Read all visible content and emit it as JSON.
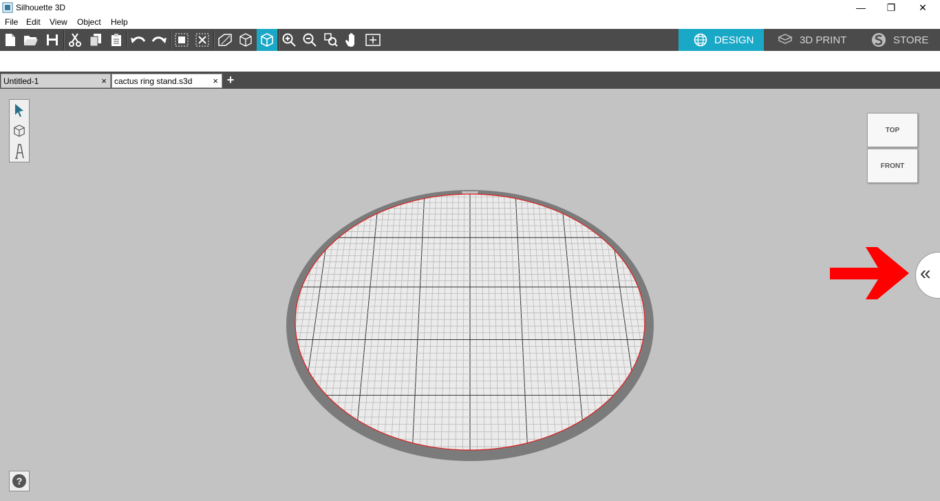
{
  "window": {
    "title": "Silhouette 3D",
    "minimize": "—",
    "restore": "❐",
    "close": "✕"
  },
  "menu": [
    "File",
    "Edit",
    "View",
    "Object",
    "Help"
  ],
  "toolbar": {
    "icons": [
      "new-file-icon",
      "open-folder-icon",
      "save-icon",
      "cut-icon",
      "copy-icon",
      "paste-icon",
      "undo-icon",
      "redo-icon",
      "group-icon",
      "ungroup-icon",
      "perspective-view-icon",
      "wireframe-cube-icon",
      "solid-cube-icon",
      "zoom-in-icon",
      "zoom-out-icon",
      "zoom-fit-icon",
      "pan-hand-icon",
      "add-frame-icon"
    ],
    "active": "solid-cube-icon"
  },
  "modes": [
    {
      "label": "DESIGN",
      "icon": "globe-icon",
      "active": true
    },
    {
      "label": "3D PRINT",
      "icon": "print-bed-icon",
      "active": false
    },
    {
      "label": "STORE",
      "icon": "silhouette-s-icon",
      "active": false
    }
  ],
  "tabs": [
    {
      "label": "Untitled-1",
      "close": "×",
      "active": false
    },
    {
      "label": "cactus ring stand.s3d",
      "close": "×",
      "active": true
    }
  ],
  "add_tab": "+",
  "tools": [
    "select-arrow-icon",
    "cube-icon",
    "text-icon"
  ],
  "viewcube": {
    "top": "TOP",
    "front": "FRONT"
  },
  "panel_toggle": "«",
  "help": "?",
  "colors": {
    "accent": "#1aa8c7",
    "toolbar": "#4b4b4b",
    "canvas": "#c3c3c3",
    "bed_rim": "#7d7d7d",
    "bed_surface": "#eaeaea",
    "bed_edge": "#e02020",
    "callout_arrow": "#ff0000"
  }
}
